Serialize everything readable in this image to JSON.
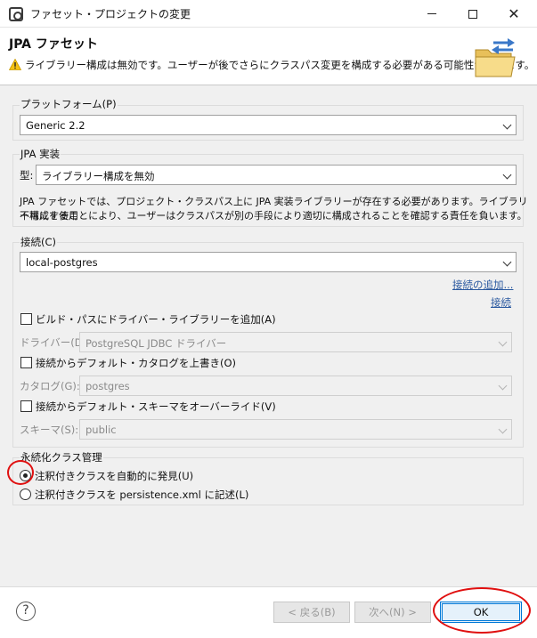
{
  "window": {
    "title": "ファセット・プロジェクトの変更",
    "controls": {
      "minimize": "minimize-icon",
      "maximize": "maximize-icon",
      "close": "close-icon"
    }
  },
  "header": {
    "title": "JPA ファセット",
    "warning": "ライブラリー構成は無効です。ユーザーが後でさらにクラスパス変更を構成する必要がある可能性があります。",
    "image": "folder-sync-icon"
  },
  "platform": {
    "label": "プラットフォーム(P)",
    "value": "Generic 2.2"
  },
  "implementation": {
    "label": "JPA 実装",
    "type_label": "型:",
    "type_value": "ライブラリー構成を無効",
    "description_line1": "JPA ファセットでは、プロジェクト・クラスパス上に JPA 実装ライブラリーが存在する必要があります。ライブラリー構成を使用",
    "description_line2": "不可にすることにより、ユーザーはクラスパスが別の手段により適切に構成されることを確認する責任を負います。"
  },
  "connection": {
    "label": "接続(C)",
    "value": "local-postgres",
    "add_link": "接続の追加...",
    "connect_link": "接続",
    "add_driver_checkbox": "ビルド・パスにドライバー・ライブラリーを追加(A)",
    "driver_label": "ドライバー(D):",
    "driver_value": "PostgreSQL JDBC ドライバー",
    "override_catalog_checkbox": "接続からデフォルト・カタログを上書き(O)",
    "catalog_label": "カタログ(G):",
    "catalog_value": "postgres",
    "override_schema_checkbox": "接続からデフォルト・スキーマをオーバーライド(V)",
    "schema_label": "スキーマ(S):",
    "schema_value": "public"
  },
  "persistence": {
    "label": "永続化クラス管理",
    "option_auto": "注釈付きクラスを自動的に発見(U)",
    "option_xml": "注釈付きクラスを persistence.xml に記述(L)",
    "selected": "option_auto"
  },
  "buttons": {
    "help": "?",
    "back": "< 戻る(B)",
    "next": "次へ(N) >",
    "ok": "OK"
  },
  "colors": {
    "annotation": "#e01010",
    "link": "#2c5aa0",
    "default_button_border": "#0078d7"
  }
}
